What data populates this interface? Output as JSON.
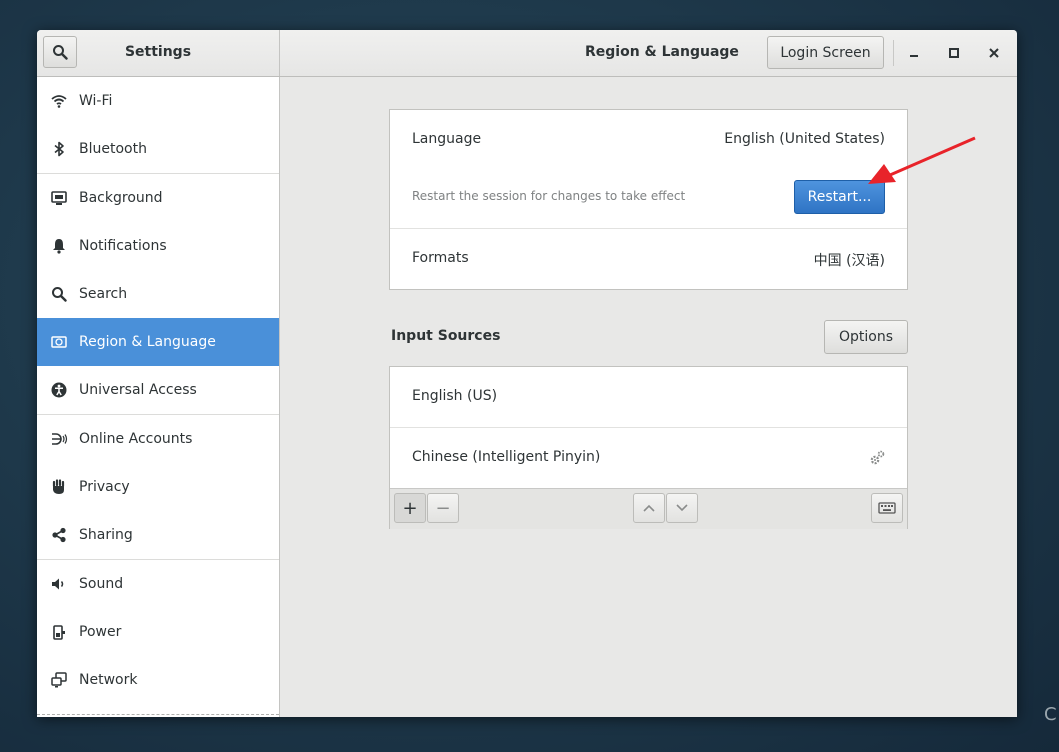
{
  "window": {
    "sidebar_title": "Settings",
    "page_title": "Region & Language",
    "login_screen_label": "Login Screen"
  },
  "sidebar": {
    "items": [
      {
        "label": "Wi-Fi",
        "icon": "wifi-icon"
      },
      {
        "label": "Bluetooth",
        "icon": "bluetooth-icon"
      },
      {
        "label": "Background",
        "icon": "background-icon"
      },
      {
        "label": "Notifications",
        "icon": "bell-icon"
      },
      {
        "label": "Search",
        "icon": "search-icon"
      },
      {
        "label": "Region & Language",
        "icon": "region-icon",
        "active": true
      },
      {
        "label": "Universal Access",
        "icon": "accessibility-icon"
      },
      {
        "label": "Online Accounts",
        "icon": "online-accounts-icon"
      },
      {
        "label": "Privacy",
        "icon": "hand-icon"
      },
      {
        "label": "Sharing",
        "icon": "share-icon"
      },
      {
        "label": "Sound",
        "icon": "speaker-icon"
      },
      {
        "label": "Power",
        "icon": "power-icon"
      },
      {
        "label": "Network",
        "icon": "network-icon"
      }
    ]
  },
  "language_panel": {
    "language_label": "Language",
    "language_value": "English (United States)",
    "restart_hint": "Restart the session for changes to take effect",
    "restart_label": "Restart...",
    "formats_label": "Formats",
    "formats_value": "中国 (汉语)"
  },
  "input_sources": {
    "heading": "Input Sources",
    "options_label": "Options",
    "sources": [
      "English (US)",
      "Chinese (Intelligent Pinyin)"
    ],
    "add_label": "+",
    "remove_label": "−"
  },
  "colors": {
    "accent": "#4a90d9",
    "annotation_arrow": "#e8232a"
  }
}
